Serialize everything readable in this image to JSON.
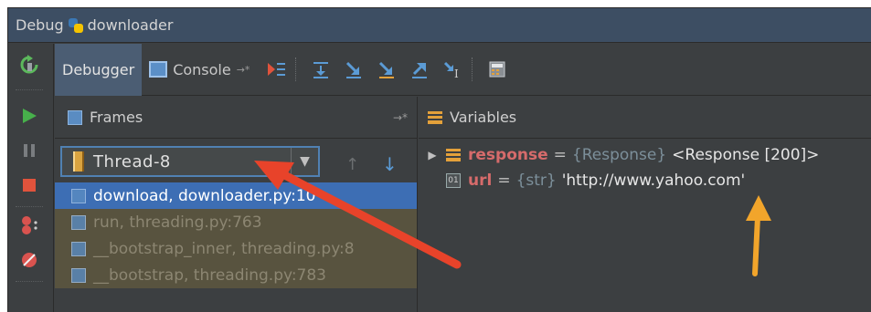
{
  "window": {
    "title_prefix": "Debug",
    "title_name": "downloader"
  },
  "toolbar": {
    "debugger_tab": "Debugger",
    "console_tab": "Console",
    "console_pin": "→*"
  },
  "frames": {
    "header": "Frames",
    "pin": "→*",
    "thread_selected": "Thread-8",
    "items": [
      "download, downloader.py:10",
      "run, threading.py:763",
      "__bootstrap_inner, threading.py:8",
      "__bootstrap, threading.py:783"
    ]
  },
  "variables": {
    "header": "Variables",
    "rows": [
      {
        "name": "response",
        "eq": "=",
        "type": "{Response}",
        "value": "<Response [200]>"
      },
      {
        "name": "url",
        "eq": "=",
        "type": "{str}",
        "value": "'http://www.yahoo.com'"
      }
    ]
  },
  "colors": {
    "annotation_red": "#e8432a",
    "annotation_orange": "#f2a52b",
    "selection": "#3d6eb4"
  }
}
